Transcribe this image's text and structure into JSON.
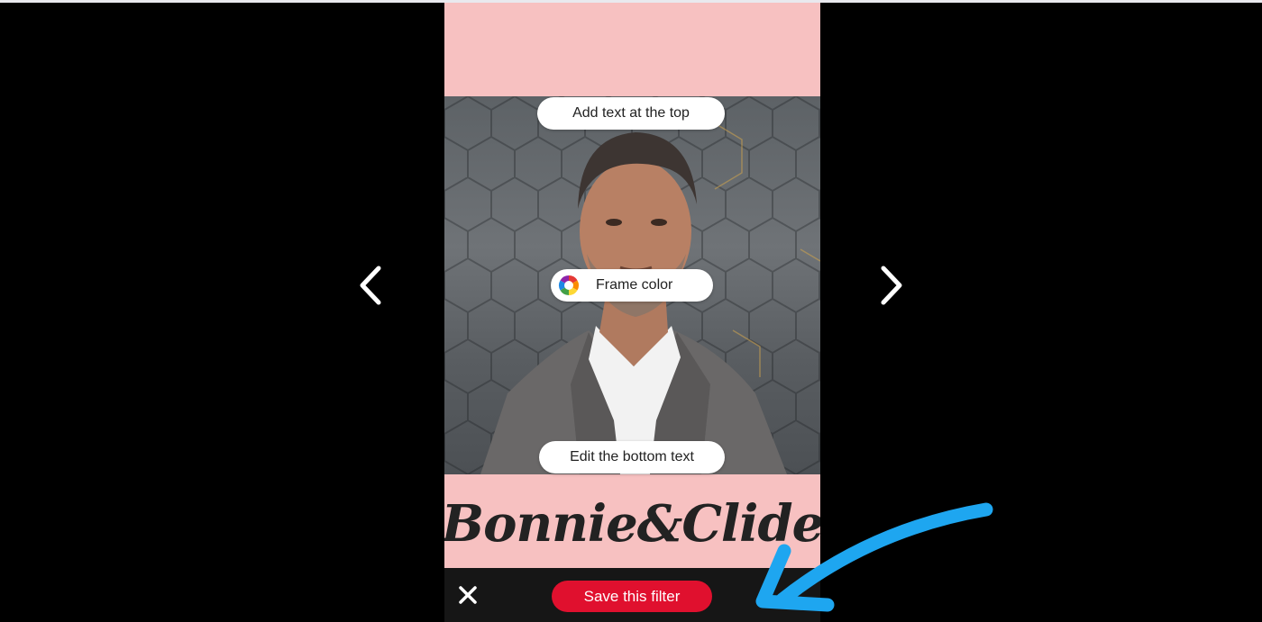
{
  "editor": {
    "top_text_button": "Add text at the top",
    "frame_color_button": "Frame color",
    "bottom_text_button": "Edit the bottom text",
    "brand_text": "Bonnie&Clide",
    "save_button": "Save this filter"
  },
  "icons": {
    "prev": "chevron-left-icon",
    "next": "chevron-right-icon",
    "close": "close-icon",
    "color_wheel": "color-wheel-icon",
    "annotation": "arrow-annotation"
  },
  "colors": {
    "frame_background": "#f7c1c1",
    "save_button": "#e0102e",
    "annotation_arrow": "#1ea6f0",
    "page_background": "#000000"
  }
}
